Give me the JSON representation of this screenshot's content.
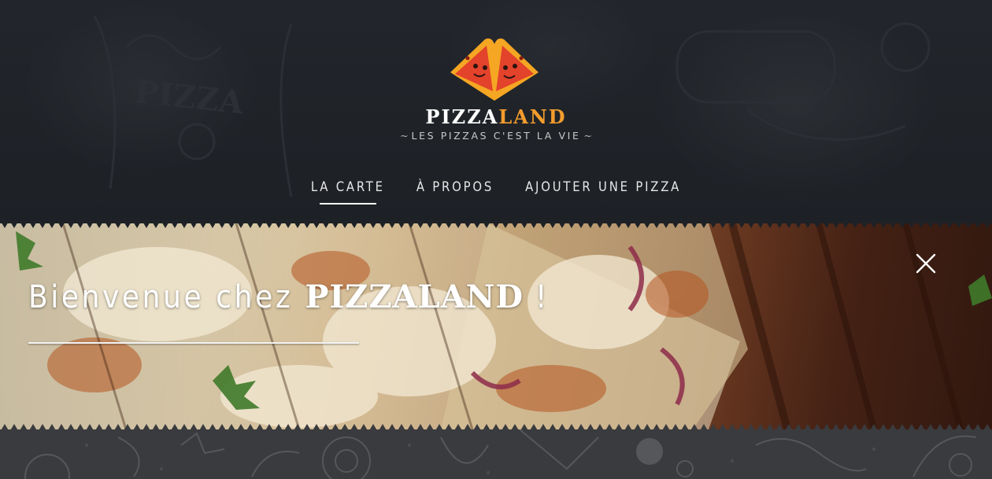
{
  "header": {
    "brand_part1": "PIZZA",
    "brand_part2": "LAND",
    "tagline": "LES PIZZAS C'EST LA VIE",
    "logo_icon": "pizza-slices-logo-icon"
  },
  "nav": {
    "items": [
      {
        "label": "LA CARTE",
        "active": true
      },
      {
        "label": "À PROPOS",
        "active": false
      },
      {
        "label": "AJOUTER UNE PIZZA",
        "active": false
      }
    ]
  },
  "hero": {
    "welcome": "Bienvenue chez",
    "brand_part1": "PIZZA",
    "brand_part2": "LAND",
    "exclamation": "!",
    "close_icon": "close-icon"
  },
  "colors": {
    "accent": "#f39c2d",
    "logo_red": "#e3422b",
    "logo_yellow": "#f5a623",
    "background": "#1f2328"
  }
}
